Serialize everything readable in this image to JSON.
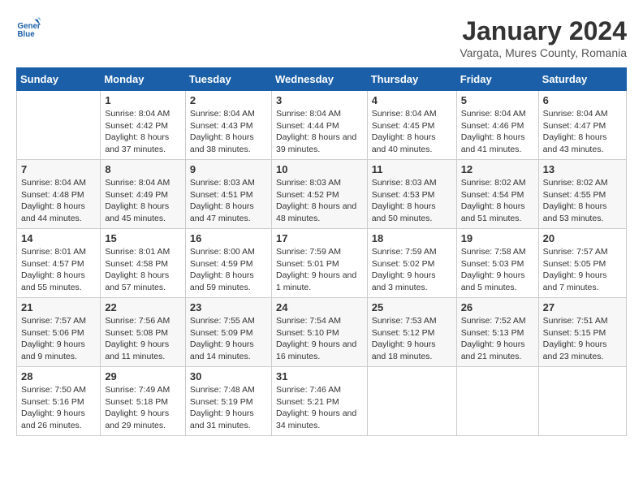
{
  "header": {
    "logo_line1": "General",
    "logo_line2": "Blue",
    "title": "January 2024",
    "location": "Vargata, Mures County, Romania"
  },
  "columns": [
    "Sunday",
    "Monday",
    "Tuesday",
    "Wednesday",
    "Thursday",
    "Friday",
    "Saturday"
  ],
  "weeks": [
    [
      {
        "num": "",
        "sunrise": "",
        "sunset": "",
        "daylight": ""
      },
      {
        "num": "1",
        "sunrise": "Sunrise: 8:04 AM",
        "sunset": "Sunset: 4:42 PM",
        "daylight": "Daylight: 8 hours and 37 minutes."
      },
      {
        "num": "2",
        "sunrise": "Sunrise: 8:04 AM",
        "sunset": "Sunset: 4:43 PM",
        "daylight": "Daylight: 8 hours and 38 minutes."
      },
      {
        "num": "3",
        "sunrise": "Sunrise: 8:04 AM",
        "sunset": "Sunset: 4:44 PM",
        "daylight": "Daylight: 8 hours and 39 minutes."
      },
      {
        "num": "4",
        "sunrise": "Sunrise: 8:04 AM",
        "sunset": "Sunset: 4:45 PM",
        "daylight": "Daylight: 8 hours and 40 minutes."
      },
      {
        "num": "5",
        "sunrise": "Sunrise: 8:04 AM",
        "sunset": "Sunset: 4:46 PM",
        "daylight": "Daylight: 8 hours and 41 minutes."
      },
      {
        "num": "6",
        "sunrise": "Sunrise: 8:04 AM",
        "sunset": "Sunset: 4:47 PM",
        "daylight": "Daylight: 8 hours and 43 minutes."
      }
    ],
    [
      {
        "num": "7",
        "sunrise": "Sunrise: 8:04 AM",
        "sunset": "Sunset: 4:48 PM",
        "daylight": "Daylight: 8 hours and 44 minutes."
      },
      {
        "num": "8",
        "sunrise": "Sunrise: 8:04 AM",
        "sunset": "Sunset: 4:49 PM",
        "daylight": "Daylight: 8 hours and 45 minutes."
      },
      {
        "num": "9",
        "sunrise": "Sunrise: 8:03 AM",
        "sunset": "Sunset: 4:51 PM",
        "daylight": "Daylight: 8 hours and 47 minutes."
      },
      {
        "num": "10",
        "sunrise": "Sunrise: 8:03 AM",
        "sunset": "Sunset: 4:52 PM",
        "daylight": "Daylight: 8 hours and 48 minutes."
      },
      {
        "num": "11",
        "sunrise": "Sunrise: 8:03 AM",
        "sunset": "Sunset: 4:53 PM",
        "daylight": "Daylight: 8 hours and 50 minutes."
      },
      {
        "num": "12",
        "sunrise": "Sunrise: 8:02 AM",
        "sunset": "Sunset: 4:54 PM",
        "daylight": "Daylight: 8 hours and 51 minutes."
      },
      {
        "num": "13",
        "sunrise": "Sunrise: 8:02 AM",
        "sunset": "Sunset: 4:55 PM",
        "daylight": "Daylight: 8 hours and 53 minutes."
      }
    ],
    [
      {
        "num": "14",
        "sunrise": "Sunrise: 8:01 AM",
        "sunset": "Sunset: 4:57 PM",
        "daylight": "Daylight: 8 hours and 55 minutes."
      },
      {
        "num": "15",
        "sunrise": "Sunrise: 8:01 AM",
        "sunset": "Sunset: 4:58 PM",
        "daylight": "Daylight: 8 hours and 57 minutes."
      },
      {
        "num": "16",
        "sunrise": "Sunrise: 8:00 AM",
        "sunset": "Sunset: 4:59 PM",
        "daylight": "Daylight: 8 hours and 59 minutes."
      },
      {
        "num": "17",
        "sunrise": "Sunrise: 7:59 AM",
        "sunset": "Sunset: 5:01 PM",
        "daylight": "Daylight: 9 hours and 1 minute."
      },
      {
        "num": "18",
        "sunrise": "Sunrise: 7:59 AM",
        "sunset": "Sunset: 5:02 PM",
        "daylight": "Daylight: 9 hours and 3 minutes."
      },
      {
        "num": "19",
        "sunrise": "Sunrise: 7:58 AM",
        "sunset": "Sunset: 5:03 PM",
        "daylight": "Daylight: 9 hours and 5 minutes."
      },
      {
        "num": "20",
        "sunrise": "Sunrise: 7:57 AM",
        "sunset": "Sunset: 5:05 PM",
        "daylight": "Daylight: 9 hours and 7 minutes."
      }
    ],
    [
      {
        "num": "21",
        "sunrise": "Sunrise: 7:57 AM",
        "sunset": "Sunset: 5:06 PM",
        "daylight": "Daylight: 9 hours and 9 minutes."
      },
      {
        "num": "22",
        "sunrise": "Sunrise: 7:56 AM",
        "sunset": "Sunset: 5:08 PM",
        "daylight": "Daylight: 9 hours and 11 minutes."
      },
      {
        "num": "23",
        "sunrise": "Sunrise: 7:55 AM",
        "sunset": "Sunset: 5:09 PM",
        "daylight": "Daylight: 9 hours and 14 minutes."
      },
      {
        "num": "24",
        "sunrise": "Sunrise: 7:54 AM",
        "sunset": "Sunset: 5:10 PM",
        "daylight": "Daylight: 9 hours and 16 minutes."
      },
      {
        "num": "25",
        "sunrise": "Sunrise: 7:53 AM",
        "sunset": "Sunset: 5:12 PM",
        "daylight": "Daylight: 9 hours and 18 minutes."
      },
      {
        "num": "26",
        "sunrise": "Sunrise: 7:52 AM",
        "sunset": "Sunset: 5:13 PM",
        "daylight": "Daylight: 9 hours and 21 minutes."
      },
      {
        "num": "27",
        "sunrise": "Sunrise: 7:51 AM",
        "sunset": "Sunset: 5:15 PM",
        "daylight": "Daylight: 9 hours and 23 minutes."
      }
    ],
    [
      {
        "num": "28",
        "sunrise": "Sunrise: 7:50 AM",
        "sunset": "Sunset: 5:16 PM",
        "daylight": "Daylight: 9 hours and 26 minutes."
      },
      {
        "num": "29",
        "sunrise": "Sunrise: 7:49 AM",
        "sunset": "Sunset: 5:18 PM",
        "daylight": "Daylight: 9 hours and 29 minutes."
      },
      {
        "num": "30",
        "sunrise": "Sunrise: 7:48 AM",
        "sunset": "Sunset: 5:19 PM",
        "daylight": "Daylight: 9 hours and 31 minutes."
      },
      {
        "num": "31",
        "sunrise": "Sunrise: 7:46 AM",
        "sunset": "Sunset: 5:21 PM",
        "daylight": "Daylight: 9 hours and 34 minutes."
      },
      {
        "num": "",
        "sunrise": "",
        "sunset": "",
        "daylight": ""
      },
      {
        "num": "",
        "sunrise": "",
        "sunset": "",
        "daylight": ""
      },
      {
        "num": "",
        "sunrise": "",
        "sunset": "",
        "daylight": ""
      }
    ]
  ]
}
